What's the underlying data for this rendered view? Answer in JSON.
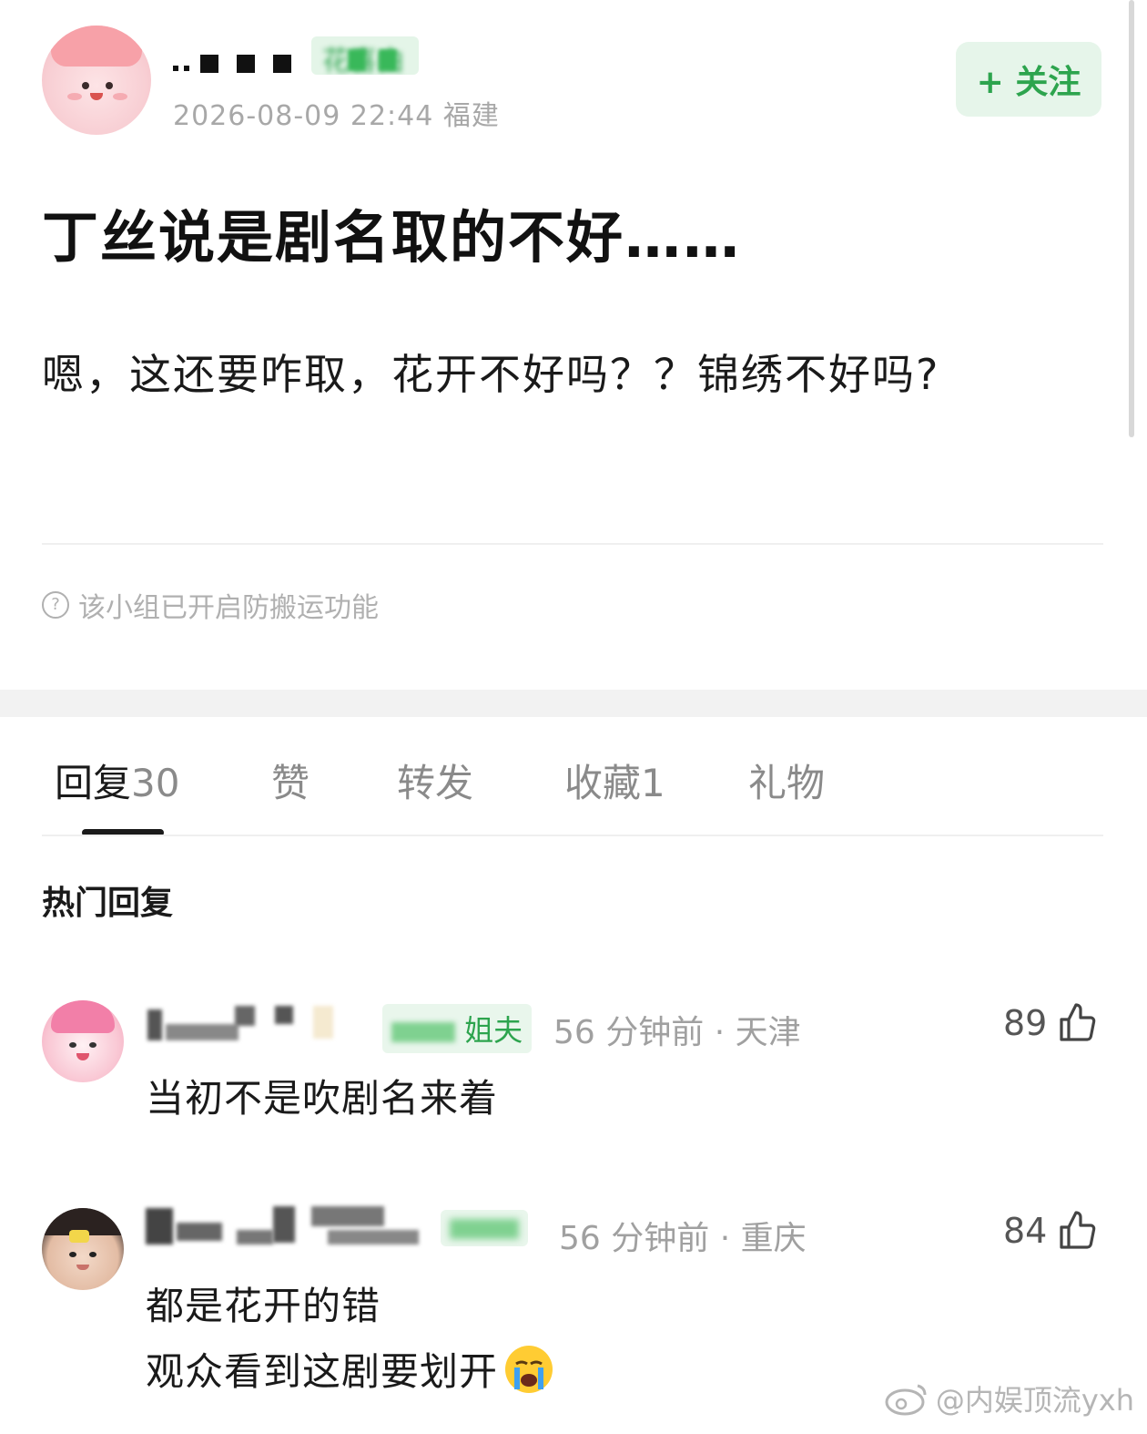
{
  "post": {
    "tag": "花喜由",
    "date_location": "2026-08-09 22:44  福建",
    "follow_label": "+ 关注",
    "title": "丁丝说是剧名取的不好……",
    "body": "嗯，这还要咋取，花开不好吗？？锦绣不好吗?",
    "notice": "该小组已开启防搬运功能"
  },
  "tabs": [
    {
      "label": "回复",
      "count": "30"
    },
    {
      "label": "赞",
      "count": ""
    },
    {
      "label": "转发",
      "count": ""
    },
    {
      "label": "收藏",
      "count": "1"
    },
    {
      "label": "礼物",
      "count": ""
    }
  ],
  "hot_replies": {
    "section_title": "热门回复",
    "items": [
      {
        "tag": "姐夫",
        "meta": "56 分钟前 · 天津",
        "text_lines": [
          "当初不是吹剧名来着"
        ],
        "likes": "89"
      },
      {
        "tag": "",
        "meta": "56 分钟前 · 重庆",
        "text_lines": [
          "都是花开的错",
          "观众看到这剧要划开"
        ],
        "likes": "84"
      }
    ]
  },
  "icons": {
    "notice": "question-circle-icon",
    "like": "thumbs-up-icon",
    "emoji": "crying-face-emoji",
    "watermark_logo": "weibo-logo"
  },
  "watermark": "@内娱顶流yxh",
  "colors": {
    "accent_green": "#2da44e",
    "tag_bg": "#e9f6ec"
  }
}
